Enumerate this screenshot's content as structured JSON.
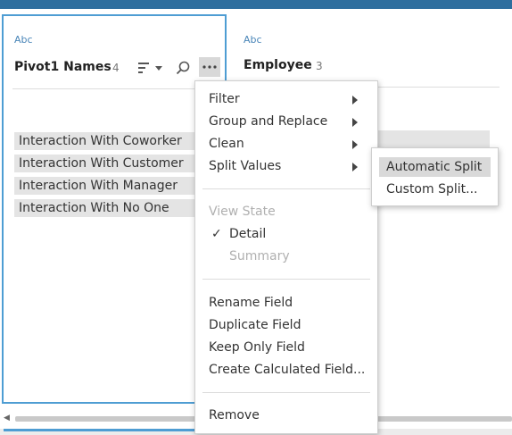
{
  "fields": [
    {
      "type_label": "Abc",
      "name": "Pivot1 Names",
      "count": "4",
      "values": [
        "Interaction With Coworker",
        "Interaction With Customer",
        "Interaction With Manager",
        "Interaction With No One"
      ]
    },
    {
      "type_label": "Abc",
      "name": "Employee",
      "count": "3"
    }
  ],
  "toolbar_icons": [
    "sort-icon",
    "chevron-down-icon",
    "search-icon",
    "more-options-icon"
  ],
  "context_menu": {
    "items_top": [
      {
        "label": "Filter",
        "has_submenu": true
      },
      {
        "label": "Group and Replace",
        "has_submenu": true
      },
      {
        "label": "Clean",
        "has_submenu": true
      },
      {
        "label": "Split Values",
        "has_submenu": true
      }
    ],
    "view_state": {
      "heading": "View State",
      "options": [
        {
          "label": "Detail",
          "checked": true,
          "enabled": true
        },
        {
          "label": "Summary",
          "checked": false,
          "enabled": false
        }
      ]
    },
    "items_field": [
      "Rename Field",
      "Duplicate Field",
      "Keep Only Field",
      "Create Calculated Field..."
    ],
    "items_bottom": [
      "Remove"
    ]
  },
  "split_submenu": {
    "items": [
      {
        "label": "Automatic Split",
        "highlighted": true
      },
      {
        "label": "Custom Split...",
        "highlighted": false
      }
    ]
  },
  "colors": {
    "accent": "#4e9dd3",
    "top_bar": "#2e6e9e",
    "value_bar": "#e4e4e4",
    "highlight": "#d9d9d9"
  }
}
